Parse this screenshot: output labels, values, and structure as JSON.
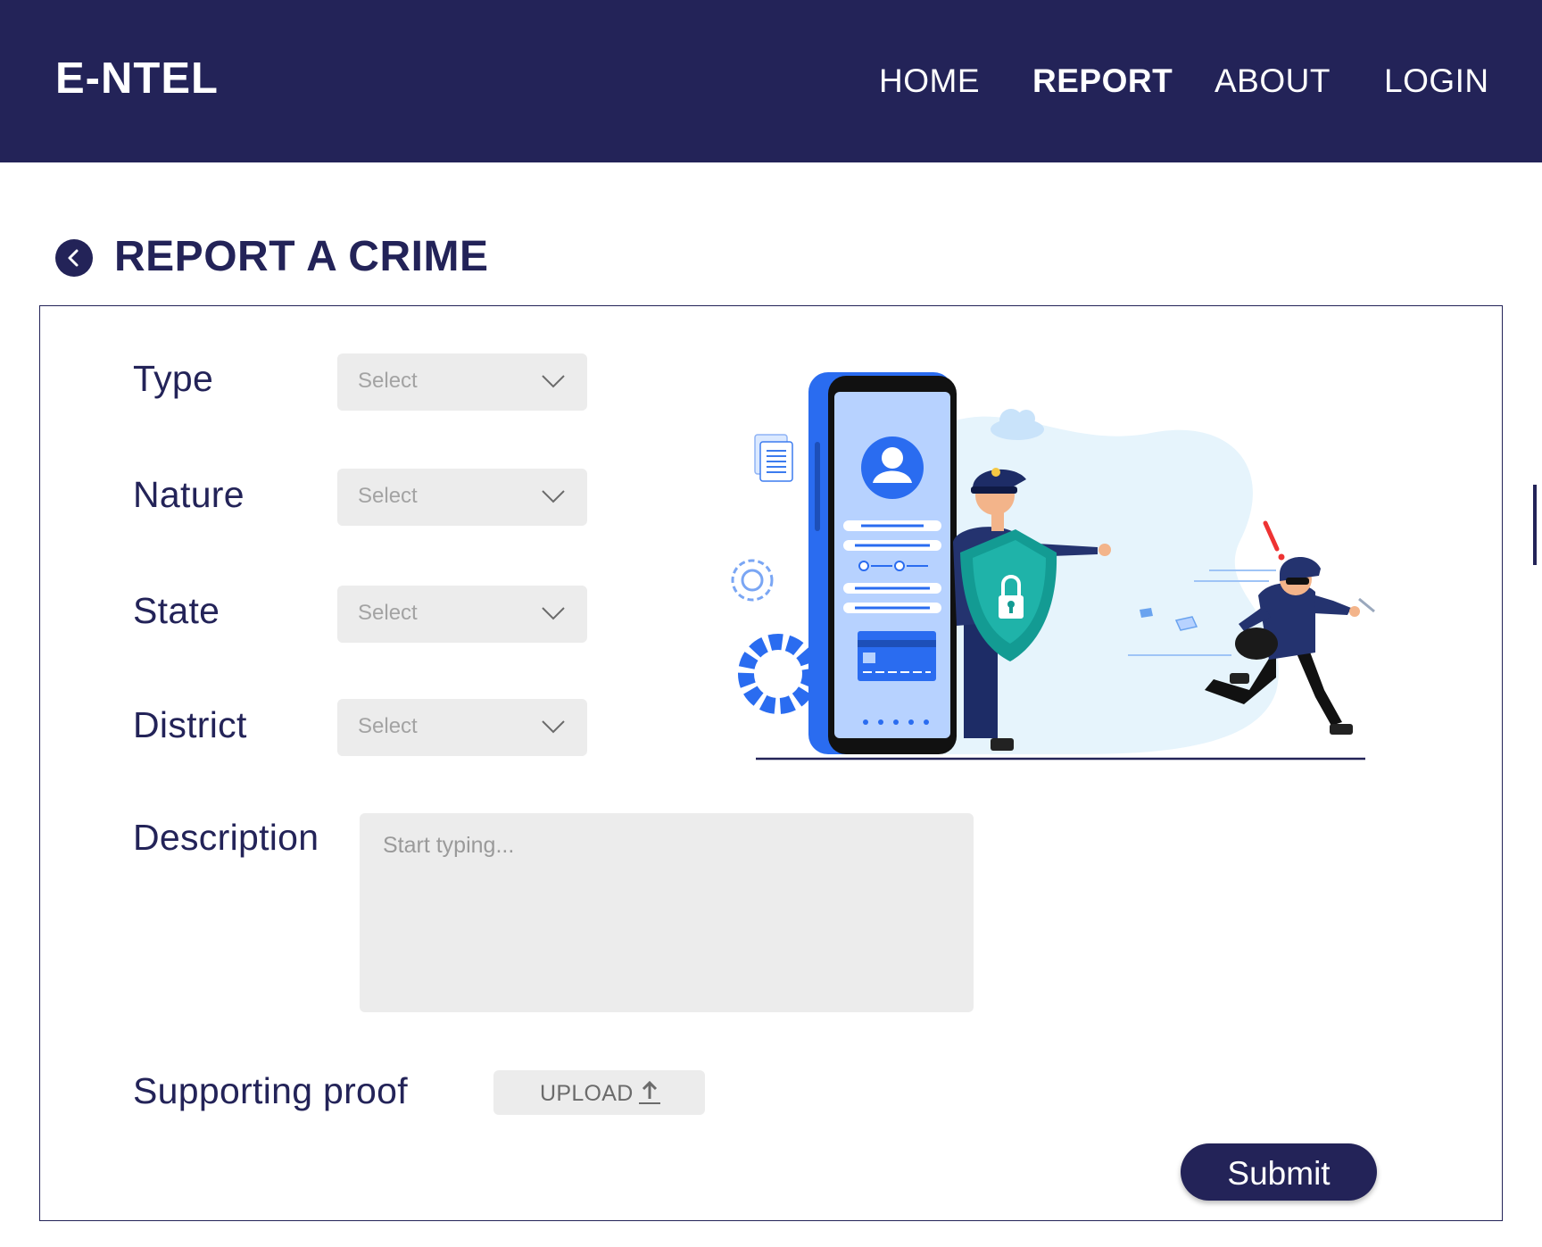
{
  "app": {
    "logo": "E-NTEL"
  },
  "nav": {
    "home": "HOME",
    "report": "REPORT",
    "about": "ABOUT",
    "login": "LOGIN",
    "active": "REPORT"
  },
  "page": {
    "title": "REPORT A CRIME"
  },
  "form": {
    "type": {
      "label": "Type",
      "value": "Select"
    },
    "nature": {
      "label": "Nature",
      "value": "Select"
    },
    "state": {
      "label": "State",
      "value": "Select"
    },
    "district": {
      "label": "District",
      "value": "Select"
    },
    "description": {
      "label": "Description",
      "placeholder": "Start typing..."
    },
    "proof": {
      "label": "Supporting proof",
      "upload_label": "UPLOAD"
    },
    "submit_label": "Submit"
  },
  "icons": {
    "back": "chevron-left-icon",
    "dropdown": "chevron-down-icon",
    "upload": "upload-arrow-icon"
  },
  "colors": {
    "brand": "#232358",
    "field_bg": "#ececec",
    "illustration_blue": "#2a6cf0",
    "shield_teal": "#139b93"
  }
}
